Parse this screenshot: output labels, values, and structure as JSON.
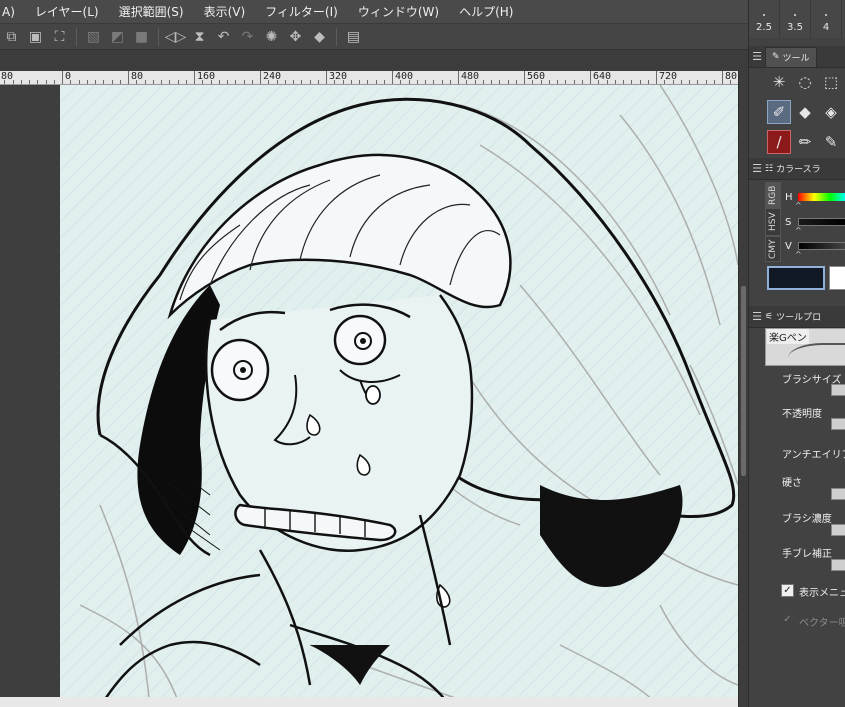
{
  "menubar": {
    "items": [
      "A)",
      "レイヤー(L)",
      "選択範囲(S)",
      "表示(V)",
      "フィルター(I)",
      "ウィンドウ(W)",
      "ヘルプ(H)"
    ]
  },
  "commandbar": {
    "icons": [
      "copy-icon",
      "paste-icon",
      "transform-icon",
      "clear-icon",
      "clear-outside-icon",
      "fill-icon",
      "flip-horizontal-icon",
      "flip-vertical-icon",
      "undo-icon",
      "redo-icon",
      "rotate-icon",
      "move-icon",
      "bucket-icon",
      "page-icon"
    ]
  },
  "brush_sizes": [
    "2.5",
    "3.5",
    "4"
  ],
  "ruler": {
    "labels": [
      "80",
      "0",
      "80",
      "160",
      "240",
      "320",
      "400",
      "480",
      "560",
      "640",
      "720",
      "80"
    ]
  },
  "tool_panel": {
    "tab_label": "ツール",
    "tools": [
      "magic-wand-icon",
      "lasso-icon",
      "rect-select-icon",
      "pen-icon",
      "eraser-icon",
      "fill-icon",
      "brush-icon",
      "pencil-icon",
      "dropper-icon"
    ]
  },
  "color_panel": {
    "tab_label": "カラースラ",
    "vtabs": [
      "RGB",
      "HSV",
      "CMY"
    ],
    "sliders": [
      "H",
      "S",
      "V"
    ],
    "main_color": "#111826",
    "sub_color": "#ffffff"
  },
  "tool_property": {
    "tab_label": "ツールプロ",
    "brush_name": "楽Gペン",
    "props": [
      "ブラシサイズ",
      "不透明度",
      "アンチエイリアス",
      "硬さ",
      "ブラシ濃度",
      "手ブレ補正"
    ],
    "check1": "表示メニュー",
    "check2": "ベクター吸着"
  },
  "canvas": {
    "paper_color": "#e2efef"
  }
}
